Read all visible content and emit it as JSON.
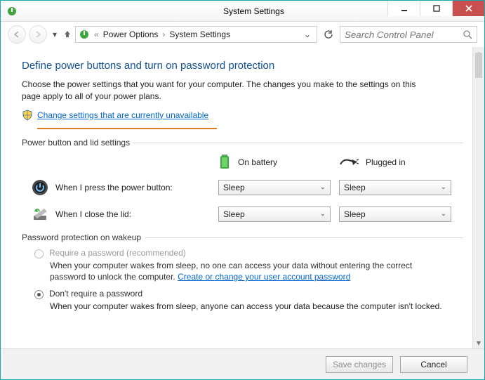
{
  "window": {
    "title": "System Settings",
    "breadcrumb": {
      "seg1": "Power Options",
      "seg2": "System Settings"
    },
    "search_placeholder": "Search Control Panel"
  },
  "page": {
    "heading": "Define power buttons and turn on password protection",
    "subtitle": "Choose the power settings that you want for your computer. The changes you make to the settings on this page apply to all of your power plans.",
    "change_link": "Change settings that are currently unavailable"
  },
  "section1": {
    "title": "Power button and lid settings",
    "col_battery": "On battery",
    "col_plugged": "Plugged in",
    "row_power_label": "When I press the power button:",
    "row_lid_label": "When I close the lid:",
    "value_sleep": "Sleep"
  },
  "section2": {
    "title": "Password protection on wakeup",
    "opt_require_label": "Require a password (recommended)",
    "opt_require_desc_pre": "When your computer wakes from sleep, no one can access your data without entering the correct password to unlock the computer. ",
    "opt_require_link": "Create or change your user account password",
    "opt_dont_label": "Don't require a password",
    "opt_dont_desc": "When your computer wakes from sleep, anyone can access your data because the computer isn't locked."
  },
  "footer": {
    "save": "Save changes",
    "cancel": "Cancel"
  }
}
